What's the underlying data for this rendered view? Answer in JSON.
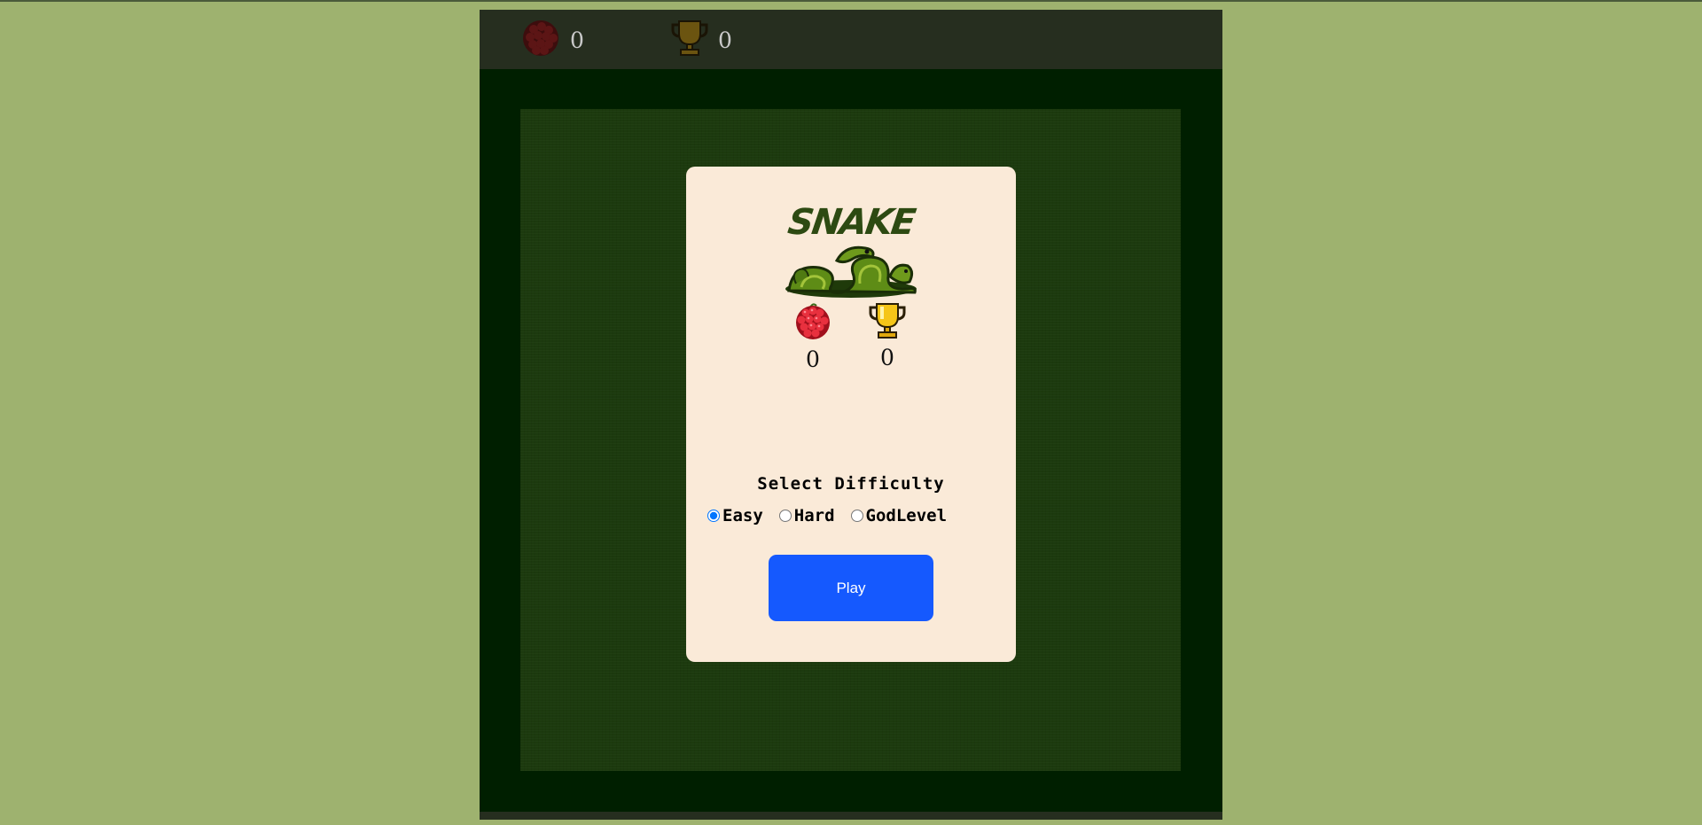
{
  "scorebar": {
    "score_value": "0",
    "highscore_value": "0",
    "score_icon": "raspberry-icon",
    "highscore_icon": "trophy-icon"
  },
  "modal": {
    "logo_text": "SNAKE",
    "stats": {
      "score_value": "0",
      "highscore_value": "0"
    },
    "difficulty_title": "Select Difficulty",
    "difficulty_options": [
      "Easy",
      "Hard",
      "GodLevel"
    ],
    "difficulty_selected": "Easy",
    "play_label": "Play"
  },
  "colors": {
    "page_background": "#9eb26f",
    "game_frame": "#001f00",
    "scorebar": "#262e1f",
    "board": "#1c3a0e",
    "modal": "#faead8",
    "play_button": "#1559fe",
    "logo": "#2d4a12"
  }
}
